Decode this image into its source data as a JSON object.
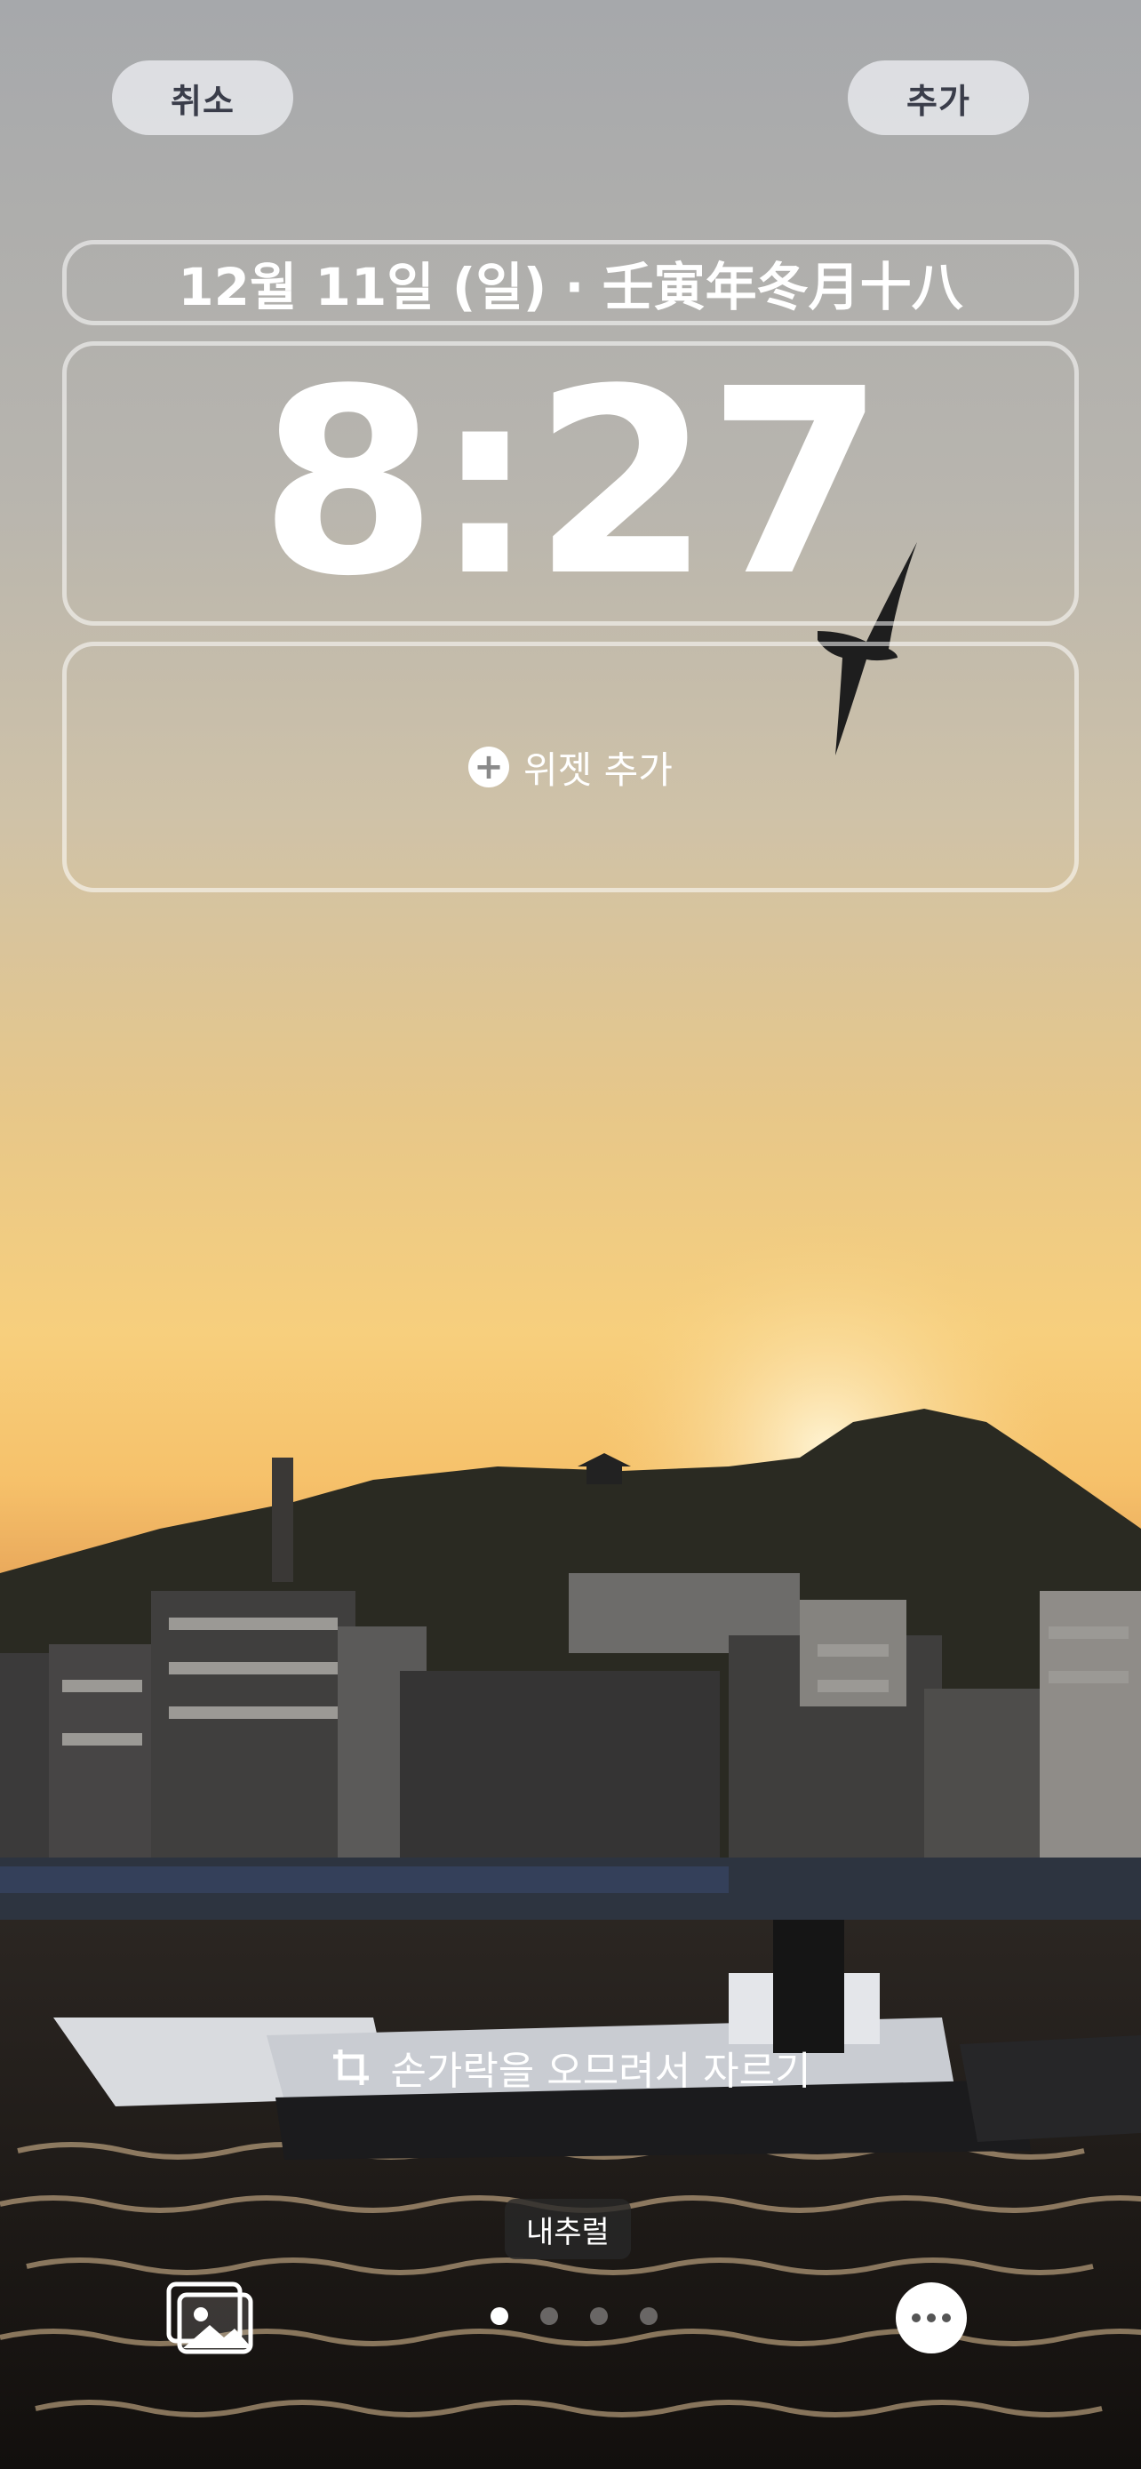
{
  "header": {
    "cancel_label": "취소",
    "add_label": "추가"
  },
  "lockscreen": {
    "date_text": "12월 11일 (일) · 壬寅年冬月十八",
    "time_text": "8:27",
    "widget_add_label": "위젯 추가"
  },
  "footer": {
    "crop_hint": "손가락을 오므려서 자르기",
    "style_label": "내추럴",
    "page_dots": 4,
    "active_dot": 0
  },
  "icons": [
    "plus-icon",
    "crop-icon",
    "photos-icon",
    "more-icon"
  ]
}
